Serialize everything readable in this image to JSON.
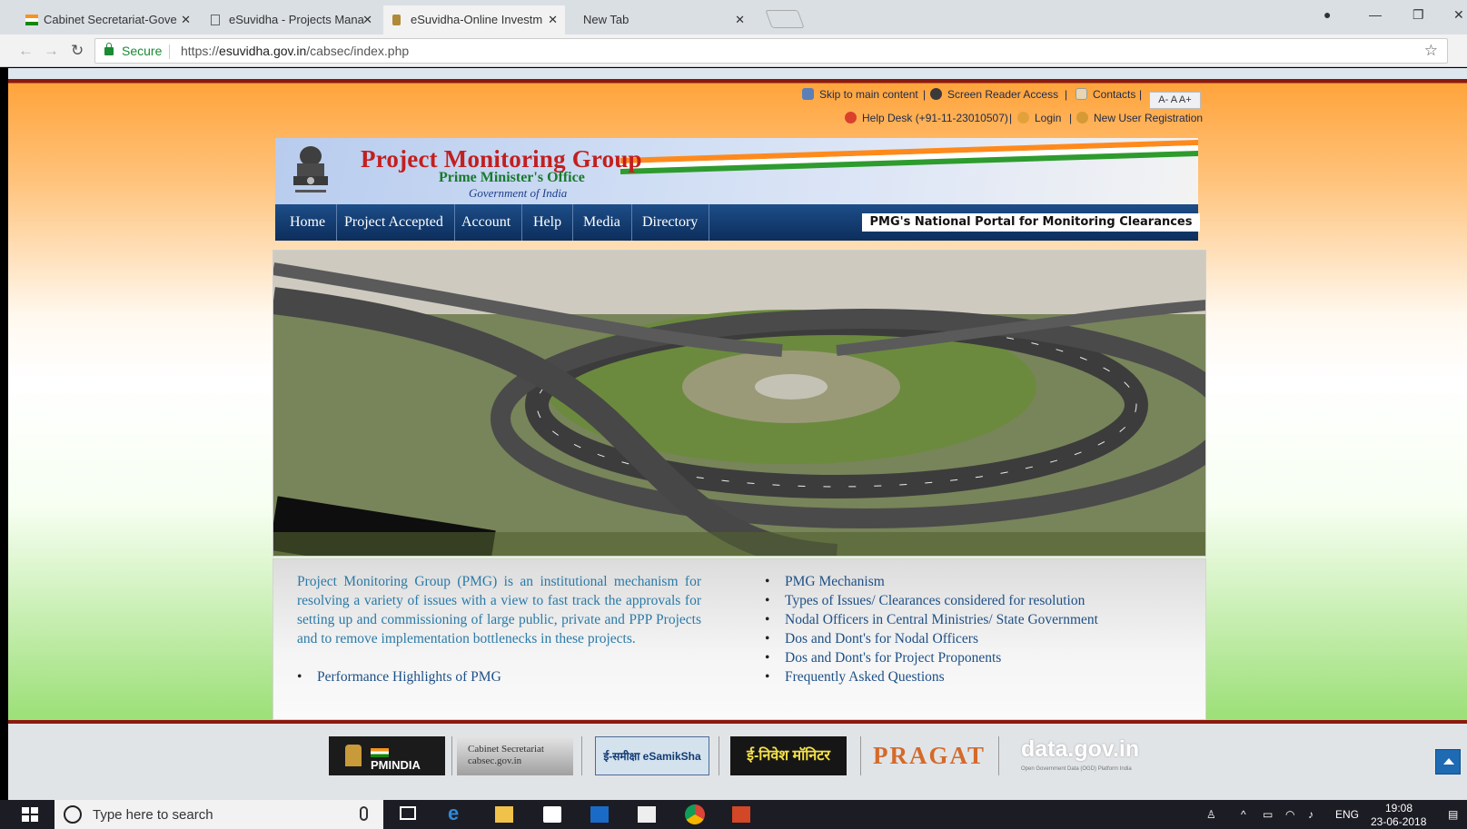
{
  "browser": {
    "tabs": [
      {
        "title": "Cabinet Secretariat-Gove",
        "active": false
      },
      {
        "title": "eSuvidha - Projects Mana",
        "active": false
      },
      {
        "title": "eSuvidha-Online Investm",
        "active": true
      },
      {
        "title": "New Tab",
        "active": false
      }
    ],
    "secure_label": "Secure",
    "url_scheme": "https://",
    "url_host": "esuvidha.gov.in",
    "url_path": "/cabsec/index.php"
  },
  "utility": {
    "skip": "Skip to main content",
    "screen_reader": "Screen Reader Access",
    "contacts": "Contacts",
    "font_sizes": "A- A A+",
    "helpdesk": "Help Desk (+91-11-23010507)",
    "login": "Login",
    "register": "New User Registration",
    "sep": "|"
  },
  "banner": {
    "title": "Project Monitoring Group",
    "subtitle": "Prime Minister's Office",
    "gov": "Government of India"
  },
  "nav": {
    "items": [
      "Home",
      "Project Accepted",
      "Account",
      "Help",
      "Media",
      "Directory"
    ],
    "portal_label": "PMG's National Portal for Monitoring Clearances"
  },
  "content": {
    "intro": "Project Monitoring Group (PMG) is an institutional mechanism for resolving a variety of issues with a view to fast track the approvals for setting up and commissioning of large public, private and PPP Projects and to remove implementation bottlenecks in these projects.",
    "left_links": [
      "Performance Highlights of PMG"
    ],
    "right_links": [
      "PMG Mechanism",
      "Types of Issues/ Clearances considered for resolution",
      "Nodal Officers in Central Ministries/ State Government",
      "Dos and Dont's for Nodal Officers",
      "Dos and Dont's for Project Proponents",
      "Frequently Asked Questions"
    ]
  },
  "footer": {
    "logos": [
      "PMINDIA",
      "Cabinet Secretariat cabsec.gov.in",
      "ई-समीक्षा eSamikSha",
      "ई-निवेश मॉनिटर",
      "PRAGATI",
      "data.gov.in"
    ],
    "datagov_sub": "Open Government Data (OGD) Platform India"
  },
  "taskbar": {
    "search_placeholder": "Type here to search",
    "lang": "ENG",
    "time": "19:08",
    "date": "23-06-2018"
  }
}
